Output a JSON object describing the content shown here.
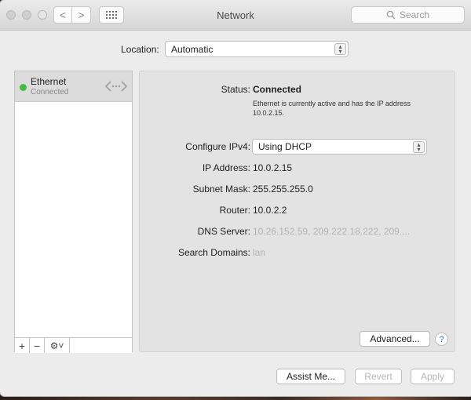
{
  "window": {
    "title": "Network",
    "search_placeholder": "Search",
    "back_glyph": "<",
    "forward_glyph": ">"
  },
  "location": {
    "label": "Location:",
    "value": "Automatic"
  },
  "sidebar": {
    "services": [
      {
        "name": "Ethernet",
        "status": "Connected",
        "status_color": "#3fbf3b"
      }
    ],
    "tools": {
      "add": "+",
      "remove": "−",
      "gear": "⚙˅"
    }
  },
  "details": {
    "status_label": "Status:",
    "status_value": "Connected",
    "status_description": "Ethernet is currently active and has the IP address 10.0.2.15.",
    "configure_label": "Configure IPv4:",
    "configure_value": "Using DHCP",
    "ip_label": "IP Address:",
    "ip_value": "10.0.2.15",
    "subnet_label": "Subnet Mask:",
    "subnet_value": "255.255.255.0",
    "router_label": "Router:",
    "router_value": "10.0.2.2",
    "dns_label": "DNS Server:",
    "dns_value": "10.26.152.59, 209.222.18.222, 209....",
    "domains_label": "Search Domains:",
    "domains_value": "lan",
    "advanced_button": "Advanced...",
    "help_glyph": "?"
  },
  "footer": {
    "assist_button": "Assist Me...",
    "revert_button": "Revert",
    "apply_button": "Apply"
  }
}
